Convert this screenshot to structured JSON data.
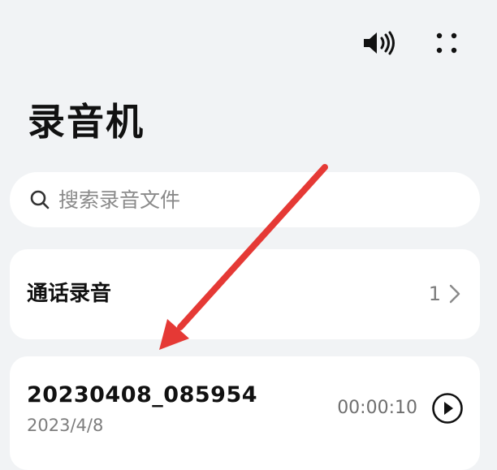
{
  "header": {
    "title": "录音机",
    "speaker_icon": "speaker-volume-icon",
    "more_icon": "more-dots-icon"
  },
  "search": {
    "placeholder": "搜索录音文件",
    "icon": "search-icon"
  },
  "call_recordings": {
    "label": "通话录音",
    "count": "1",
    "icon": "chevron-right-icon"
  },
  "recordings": [
    {
      "name": "20230408_085954",
      "date": "2023/4/8",
      "duration": "00:00:10",
      "icon": "play-icon"
    }
  ],
  "annotation": {
    "arrow_color": "#e53935"
  }
}
